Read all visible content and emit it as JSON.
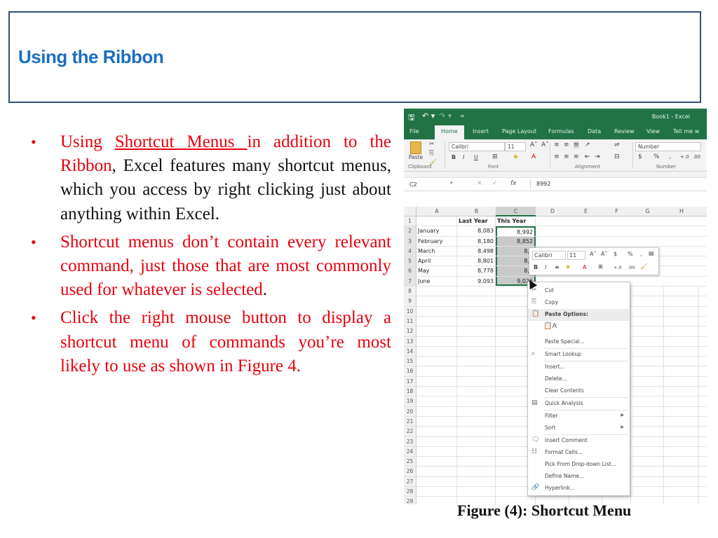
{
  "slide": {
    "title": "Using the Ribbon",
    "bullets": [
      {
        "parts": [
          {
            "text": "Using ",
            "style": "red"
          },
          {
            "text": "Shortcut Menus ",
            "style": "red-underline"
          },
          {
            "text": "in addition to the Ribbon",
            "style": "red"
          },
          {
            "text": ", Excel features many shortcut menus, which you access by right clicking just about anything within Excel.",
            "style": "black"
          }
        ]
      },
      {
        "parts": [
          {
            "text": "Shortcut menus don’t contain every relevant command, just those that are most commonly used for whatever is selected",
            "style": "red"
          },
          {
            "text": ".",
            "style": "black"
          }
        ]
      },
      {
        "parts": [
          {
            "text": "Click the right mouse button to display a shortcut menu of commands you’re most likely to use as shown in Figure 4.",
            "style": "red"
          }
        ]
      }
    ],
    "caption": "Figure (4): Shortcut Menu"
  },
  "excel": {
    "window_title": "Book1 - Excel",
    "qat": {
      "save": "🖫",
      "undo": "↶ ▾",
      "redo": "↷ ▾",
      "customize": "="
    },
    "tabs": [
      "File",
      "Home",
      "Insert",
      "Page Layout",
      "Formulas",
      "Data",
      "Review",
      "View",
      "Tell me w"
    ],
    "active_tab": "Home",
    "ribbon": {
      "paste_label": "Paste",
      "font_name": "Calibri",
      "font_size": "11",
      "number_format": "Number",
      "groups": [
        "Clipboard",
        "Font",
        "Alignment",
        "Number"
      ],
      "font_buttons": [
        "B",
        "I",
        "U"
      ],
      "number_buttons": [
        "$",
        "%",
        "‚",
        "+.0",
        ".00"
      ]
    },
    "name_box": "C2",
    "formula": "8992",
    "fx_label": "fx",
    "columns": [
      "A",
      "B",
      "C",
      "D",
      "E",
      "F",
      "G",
      "H"
    ],
    "header_row": {
      "b": "Last Year",
      "c": "This Year"
    },
    "rows": [
      {
        "n": "2",
        "a": "January",
        "b": "8,083",
        "c": "8,992"
      },
      {
        "n": "3",
        "a": "February",
        "b": "8,180",
        "c": "8,852"
      },
      {
        "n": "4",
        "a": "March",
        "b": "8,498",
        "c": "8,6"
      },
      {
        "n": "5",
        "a": "April",
        "b": "8,801",
        "c": "8,8"
      },
      {
        "n": "6",
        "a": "May",
        "b": "8,778",
        "c": "8,9"
      },
      {
        "n": "7",
        "a": "June",
        "b": "9,093",
        "c": "9,026"
      }
    ],
    "empty_rows": [
      "8",
      "9",
      "10",
      "11",
      "12",
      "13",
      "14",
      "15",
      "16",
      "17",
      "18",
      "19",
      "20",
      "21",
      "22",
      "23",
      "24",
      "25",
      "26",
      "27",
      "28",
      "29"
    ],
    "mini_toolbar": {
      "font": "Calibri",
      "size": "11",
      "buttons_top": [
        "A˄",
        "A˅",
        "$",
        "%",
        "‚"
      ],
      "buttons_bottom": [
        "B",
        "I",
        "≡",
        "A",
        "+.0",
        ".00"
      ]
    },
    "context_menu": [
      {
        "label": "Cut",
        "icon": "✂"
      },
      {
        "label": "Copy",
        "icon": "⎘"
      },
      {
        "label": "Paste Options:",
        "icon": "📋",
        "header": true
      },
      {
        "label": "",
        "icon": "📋A",
        "big": true
      },
      {
        "label": "Paste Special...",
        "icon": ""
      },
      {
        "label": "Smart Lookup",
        "icon": "⌕"
      },
      {
        "label": "Insert...",
        "icon": ""
      },
      {
        "label": "Delete...",
        "icon": ""
      },
      {
        "label": "Clear Contents",
        "icon": ""
      },
      {
        "label": "Quick Analysis",
        "icon": "▤"
      },
      {
        "label": "Filter",
        "icon": "",
        "submenu": true
      },
      {
        "label": "Sort",
        "icon": "",
        "submenu": true
      },
      {
        "label": "Insert Comment",
        "icon": "🗨"
      },
      {
        "label": "Format Cells...",
        "icon": "☷"
      },
      {
        "label": "Pick From Drop-down List...",
        "icon": ""
      },
      {
        "label": "Define Name...",
        "icon": ""
      },
      {
        "label": "Hyperlink...",
        "icon": "🔗"
      }
    ]
  }
}
